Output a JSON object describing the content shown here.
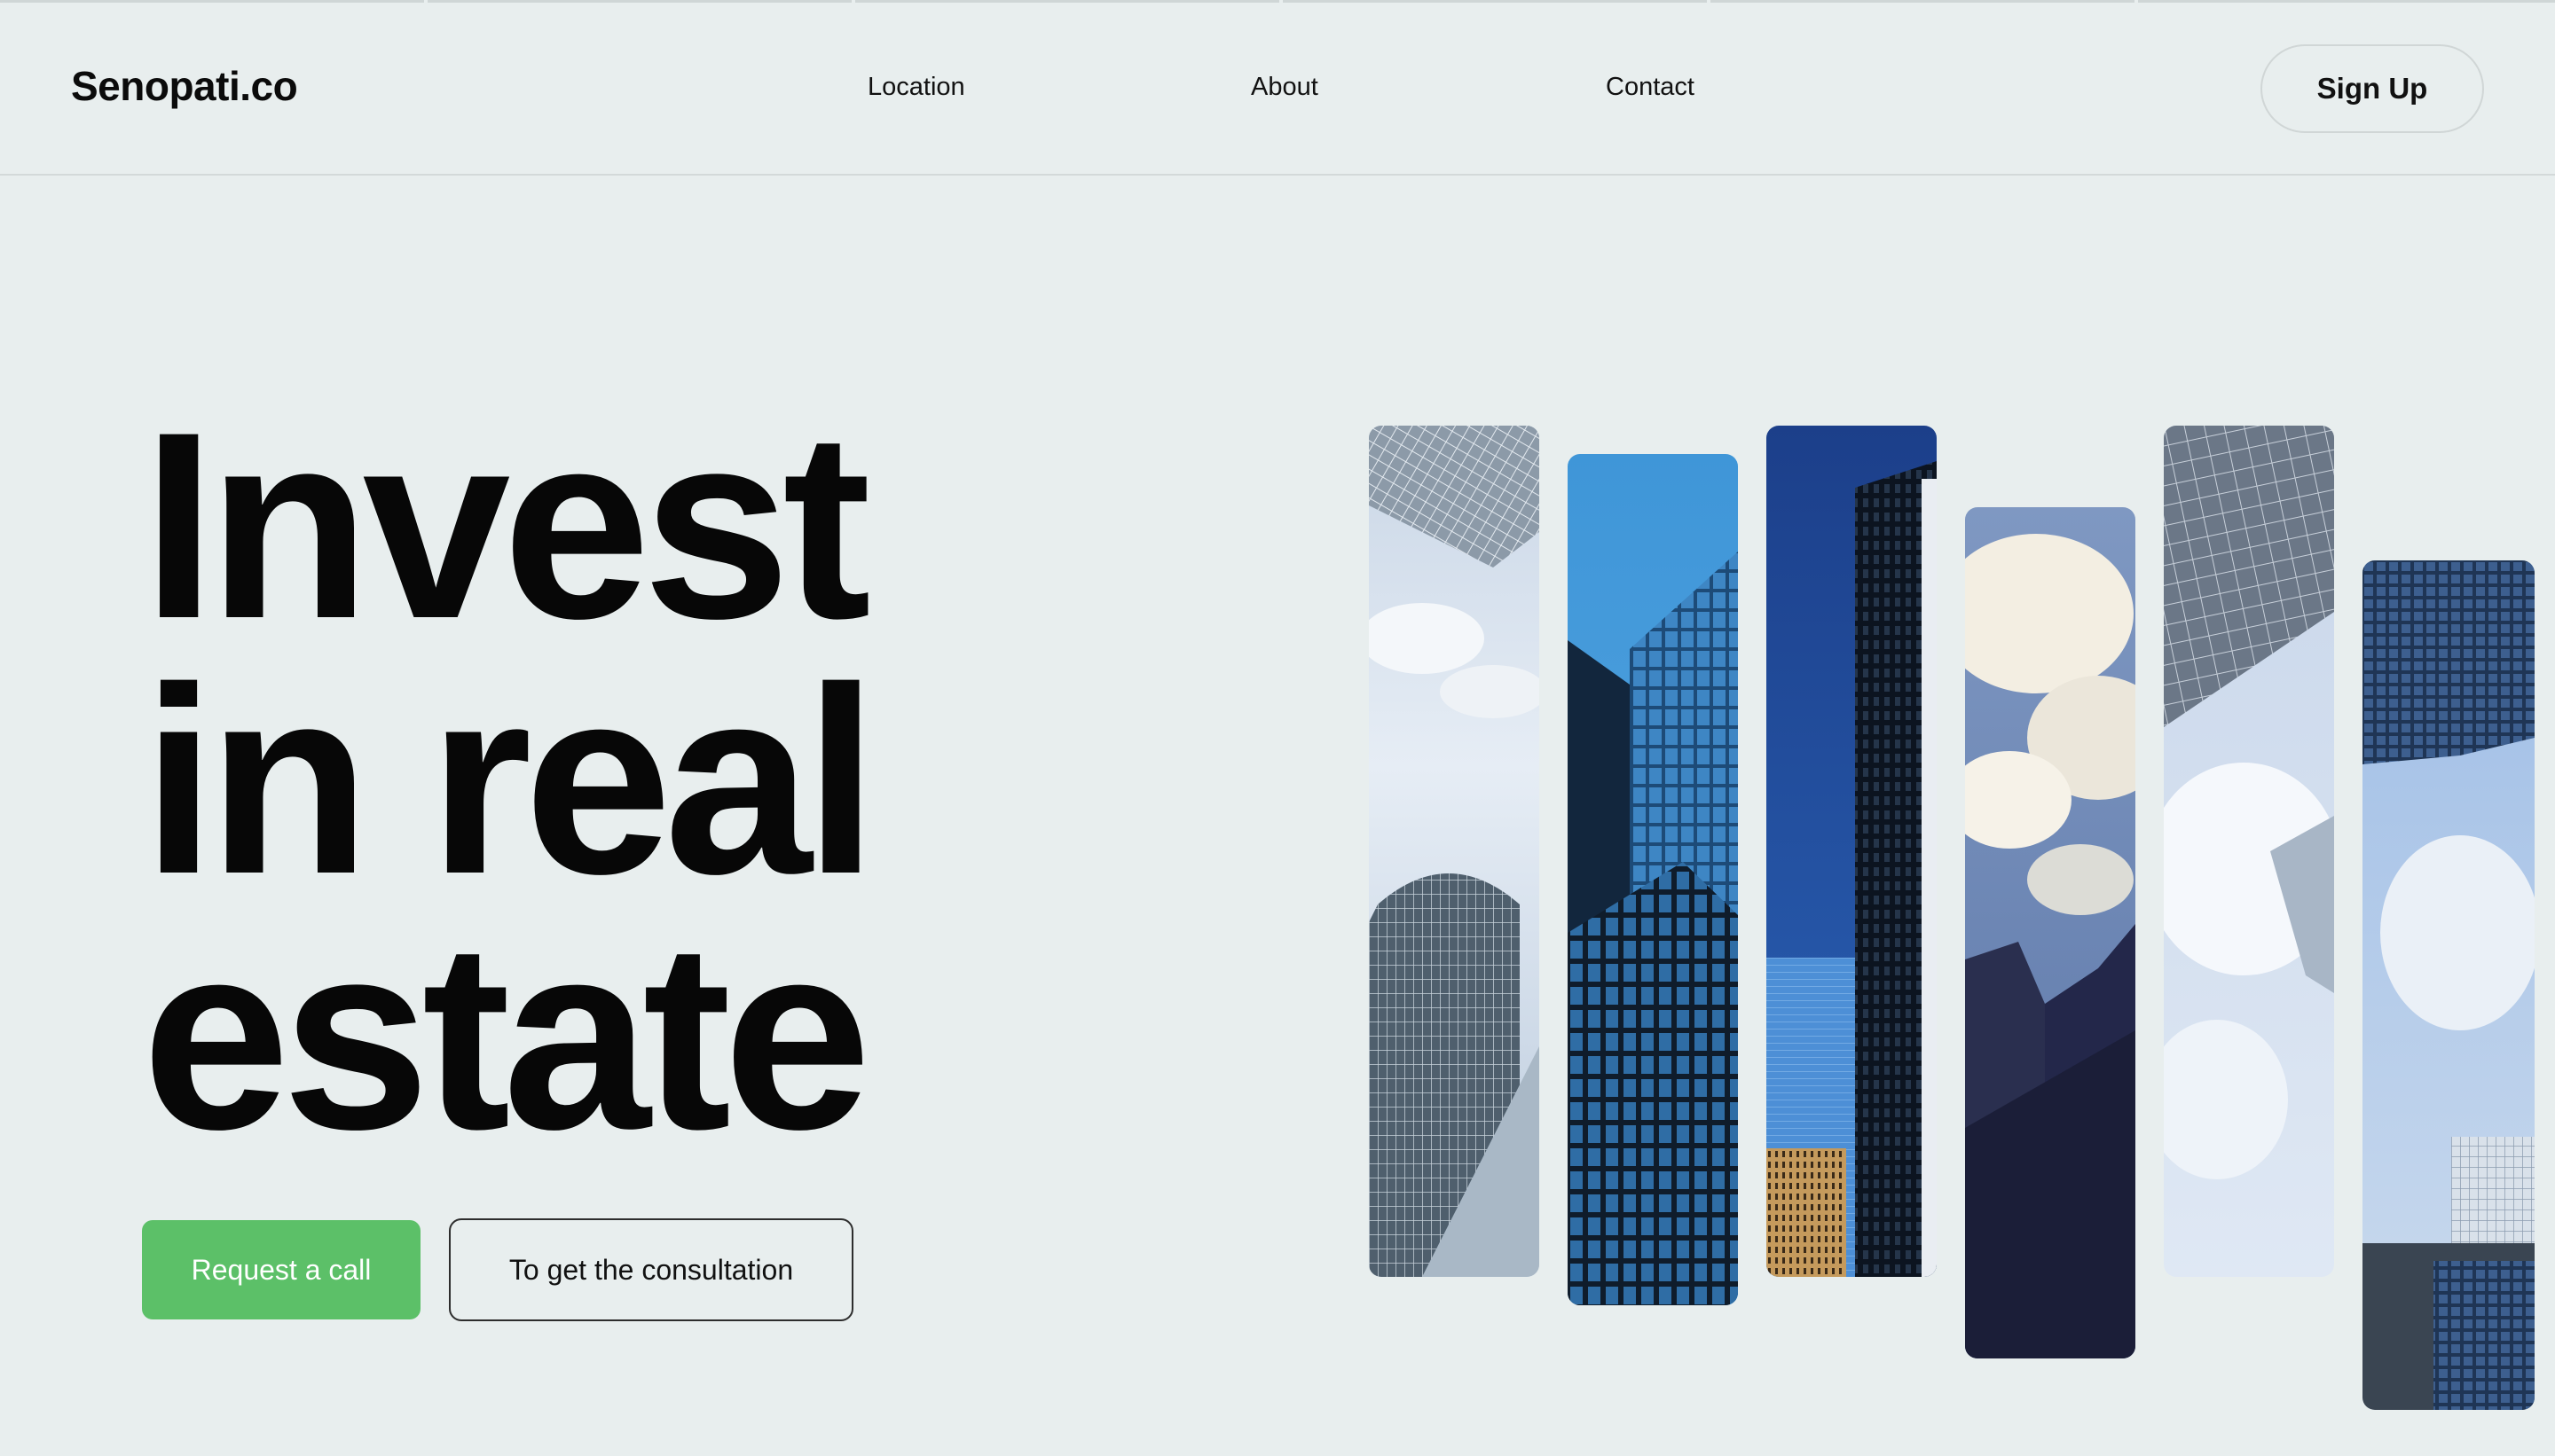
{
  "header": {
    "logo": "Senopati.co",
    "nav": [
      {
        "label": "Location"
      },
      {
        "label": "About"
      },
      {
        "label": "Contact"
      }
    ],
    "signup_label": "Sign Up"
  },
  "hero": {
    "title_lines": [
      "Invest",
      "in real",
      "estate"
    ],
    "primary_button": "Request a call",
    "secondary_button": "To get the consultation"
  },
  "gallery": {
    "images": [
      {
        "depicts": "glass skyscrapers against cloudy sky"
      },
      {
        "depicts": "blue glass tower against blue sky"
      },
      {
        "depicts": "dark skyscraper against deep blue sky"
      },
      {
        "depicts": "dark buildings under bright clouds"
      },
      {
        "depicts": "glass tower looking up into clouds"
      },
      {
        "depicts": "residential high-rise against sky"
      }
    ]
  },
  "colors": {
    "background": "#e8eeee",
    "accent_green": "#5cc068",
    "text": "#0b0b0b"
  }
}
